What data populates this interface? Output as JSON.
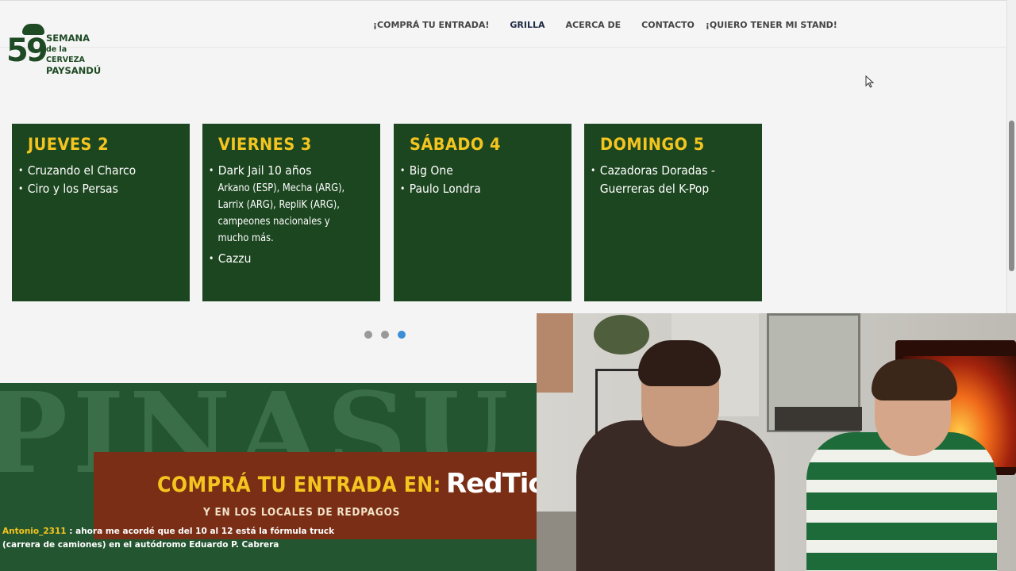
{
  "logo": {
    "number": "59",
    "line1": "SEMANA",
    "line2": "de la CERVEZA",
    "line3": "PAYSANDÚ"
  },
  "nav": {
    "items": [
      {
        "label": "¡COMPRÁ TU ENTRADA!"
      },
      {
        "label": "GRILLA"
      },
      {
        "label": "ACERCA DE"
      },
      {
        "label": "CONTACTO"
      },
      {
        "label": "¡QUIERO TENER MI STAND!"
      }
    ],
    "active": "GRILLA"
  },
  "schedule": {
    "days": [
      {
        "title": "JUEVES 2",
        "items": [
          "Cruzando el Charco",
          "Ciro y los Persas"
        ]
      },
      {
        "title": "VIERNES 3",
        "items": [
          "Dark Jail 10 años",
          "Cazzu"
        ],
        "details": "Arkano (ESP), Mecha (ARG), Larrix (ARG), RepliK (ARG), campeones nacionales y mucho más."
      },
      {
        "title": "SÁBADO 4",
        "items": [
          "Big One",
          "Paulo Londra"
        ]
      },
      {
        "title": "DOMINGO 5",
        "items": [
          "Cazadoras Doradas - Guerreras del K-Pop"
        ]
      }
    ]
  },
  "carousel": {
    "total": 3,
    "active": 3
  },
  "banner": {
    "bg_text": "PINASU",
    "title": "COMPRÁ TU ENTRADA EN:",
    "brand": "RedTic",
    "subtitle": "Y EN LOS LOCALES DE REDPAGOS"
  },
  "chat": {
    "user": "Antonio_2311",
    "message": ": ahora me acordé que del 10 al 12 está la fórmula truck (carrera de camiones) en el autódromo Eduardo P. Cabrera"
  },
  "colors": {
    "card_bg": "#1c4620",
    "card_title": "#f4c51f",
    "banner_bg": "#235530",
    "promo_bg": "#7a2e15",
    "dot_active": "#3b8fd6"
  }
}
